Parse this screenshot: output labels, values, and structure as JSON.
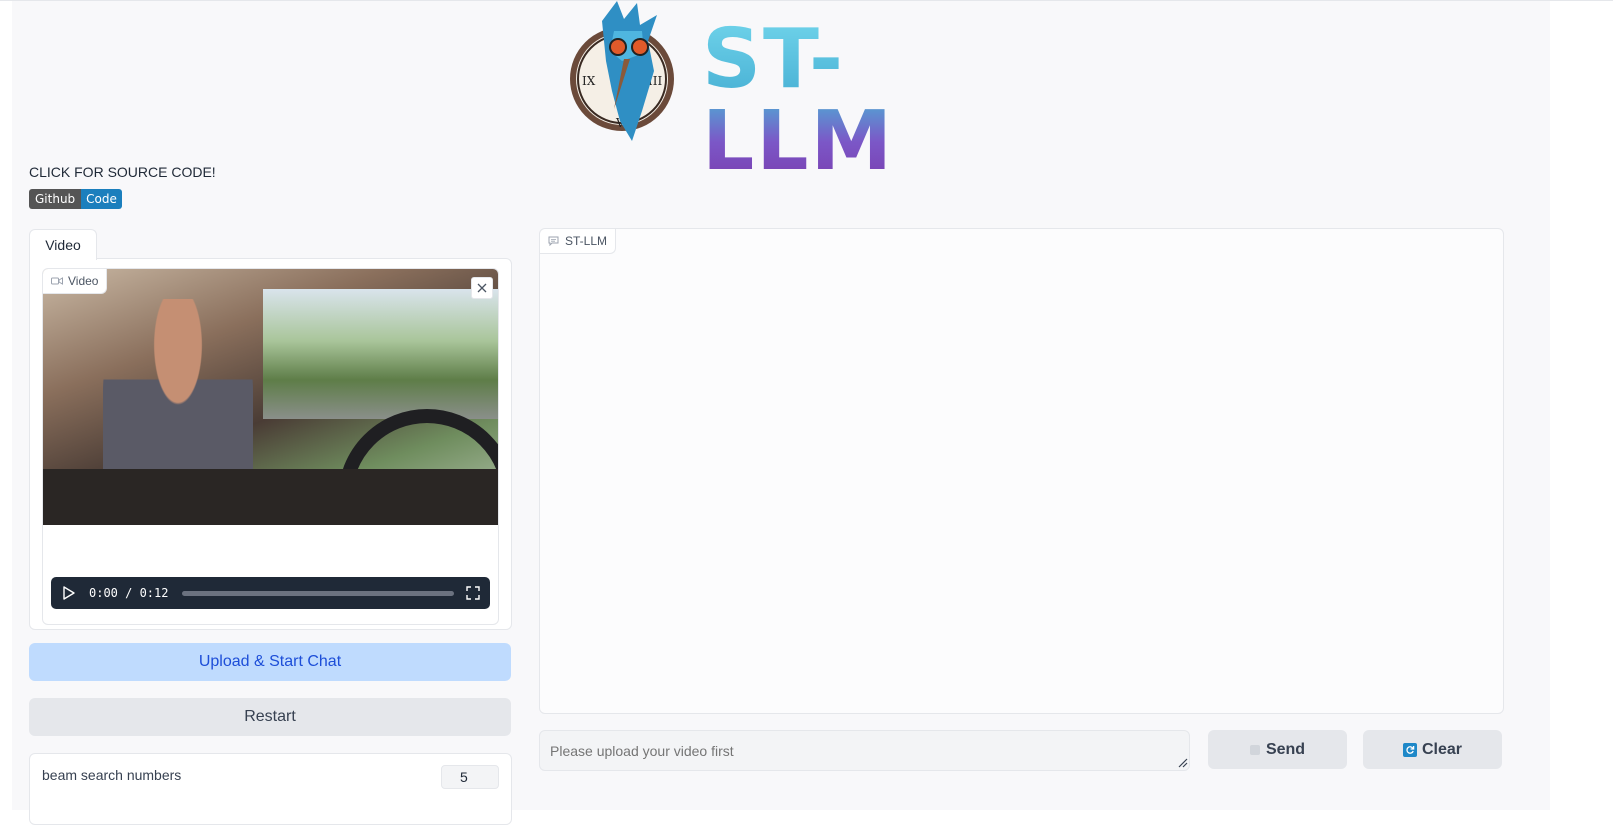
{
  "header": {
    "logo_text": "ST-LLM"
  },
  "source": {
    "text": "CLICK FOR SOURCE CODE!",
    "badge_left": "Github",
    "badge_right": "Code"
  },
  "left": {
    "tab_label": "Video",
    "video_label": "Video",
    "player": {
      "time": "0:00 / 0:12"
    },
    "upload_button": "Upload & Start Chat",
    "restart_button": "Restart",
    "beam": {
      "label": "beam search numbers",
      "value": "5"
    }
  },
  "chat": {
    "label": "ST-LLM",
    "input_placeholder": "Please upload your video first",
    "send_button": "Send",
    "clear_button": "Clear"
  },
  "colors": {
    "accent_blue": "#bfdbfe",
    "accent_blue_text": "#1d4ed8",
    "badge_dark": "#555555",
    "badge_blue": "#1b7fbd"
  }
}
